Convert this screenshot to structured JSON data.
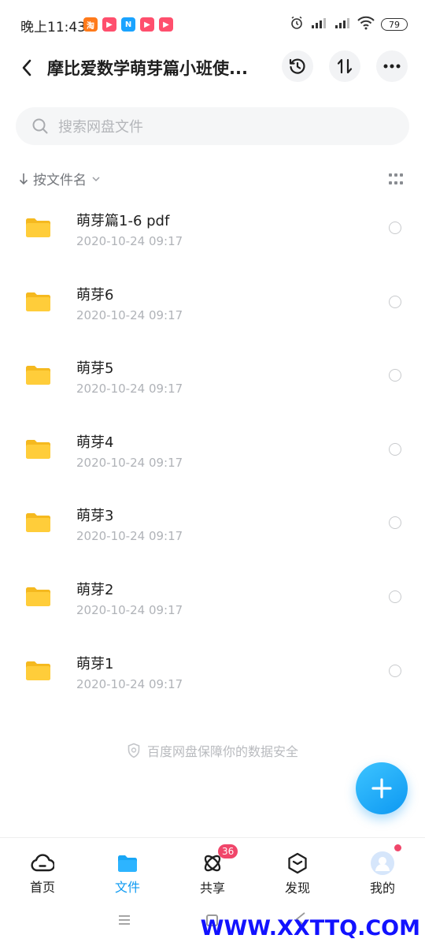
{
  "status_bar": {
    "time": "晚上11:43",
    "battery": "79",
    "apps": [
      {
        "icon": "taobao-app-icon",
        "glyph": "淘",
        "color": "#ff7a1a"
      },
      {
        "icon": "play-app-icon",
        "glyph": "▶",
        "color": "#ff4f6d"
      },
      {
        "icon": "n-app-icon",
        "glyph": "N",
        "color": "#1aa3ff"
      },
      {
        "icon": "play-app-icon",
        "glyph": "▶",
        "color": "#ff4f6d"
      },
      {
        "icon": "play-app-icon",
        "glyph": "▶",
        "color": "#ff4f6d"
      }
    ]
  },
  "header": {
    "title": "摩比爱数学萌芽篇小班使..."
  },
  "search": {
    "placeholder": "搜索网盘文件"
  },
  "sort": {
    "label": "按文件名"
  },
  "files": [
    {
      "name": "萌芽篇1-6 pdf",
      "date": "2020-10-24  09:17"
    },
    {
      "name": "萌芽6",
      "date": "2020-10-24  09:17"
    },
    {
      "name": "萌芽5",
      "date": "2020-10-24  09:17"
    },
    {
      "name": "萌芽4",
      "date": "2020-10-24  09:17"
    },
    {
      "name": "萌芽3",
      "date": "2020-10-24  09:17"
    },
    {
      "name": "萌芽2",
      "date": "2020-10-24  09:17"
    },
    {
      "name": "萌芽1",
      "date": "2020-10-24  09:17"
    }
  ],
  "footer_note": "百度网盘保障你的数据安全",
  "tabs": [
    {
      "label": "首页",
      "icon": "home-cloud-icon"
    },
    {
      "label": "文件",
      "icon": "folder-icon",
      "active": true
    },
    {
      "label": "共享",
      "icon": "share-atom-icon",
      "badge": "36"
    },
    {
      "label": "发现",
      "icon": "discover-box-icon"
    },
    {
      "label": "我的",
      "icon": "avatar-icon",
      "dot": true
    }
  ],
  "watermark": "WWW.XXTTQ.COM",
  "colors": {
    "accent": "#0c9af2",
    "folder": "#ffcd3a",
    "badge": "#f0466a"
  }
}
